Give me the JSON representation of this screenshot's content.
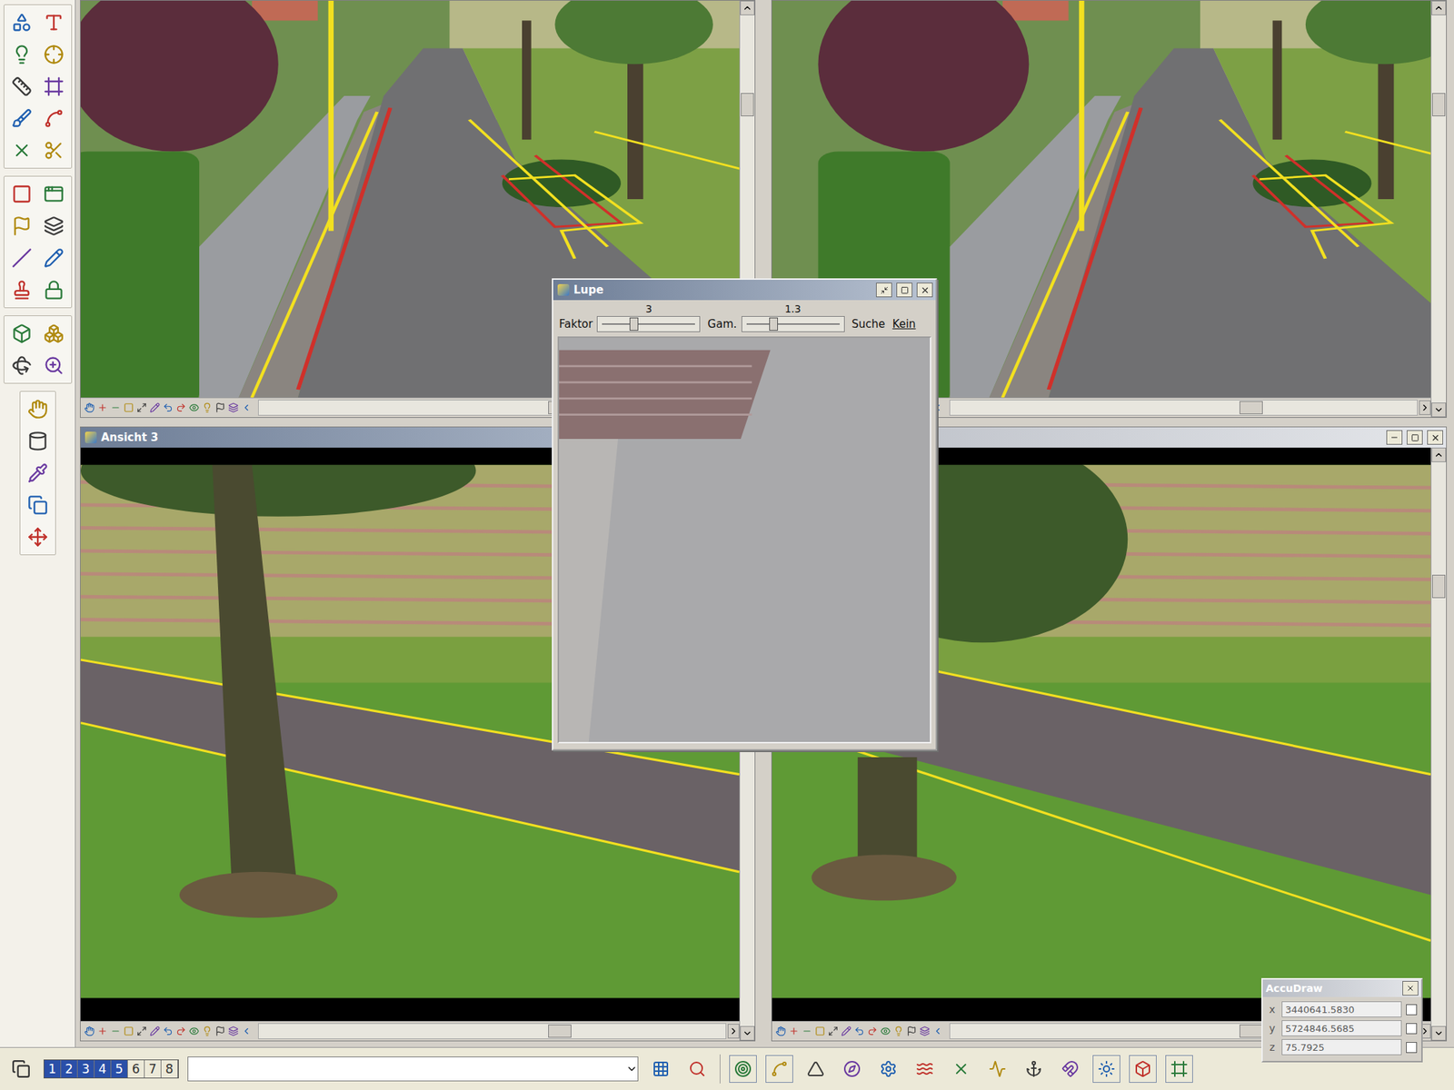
{
  "views": [
    {
      "kind": "street",
      "title": null
    },
    {
      "kind": "street",
      "title": null
    },
    {
      "kind": "field",
      "title": "Ansicht 3"
    },
    {
      "kind": "field",
      "title": ""
    }
  ],
  "magnifier": {
    "title": "Lupe",
    "sliders": [
      {
        "label": "Faktor",
        "value": "3",
        "level": 0.35
      },
      {
        "label": "Gam.",
        "value": "1.3",
        "level": 0.3
      }
    ],
    "buttons": [
      {
        "label": "Suche",
        "underlined": false
      },
      {
        "label": "Kein",
        "underlined": true
      }
    ]
  },
  "accudraw": {
    "title": "AccuDraw",
    "fields": [
      {
        "label": "x",
        "value": "3440641.5830",
        "locked": false
      },
      {
        "label": "y",
        "value": "5724846.5685",
        "locked": false
      },
      {
        "label": "z",
        "value": "75.7925",
        "locked": false
      }
    ]
  },
  "status_bar": {
    "view_buttons": [
      {
        "label": "1",
        "on": true
      },
      {
        "label": "2",
        "on": true
      },
      {
        "label": "3",
        "on": true
      },
      {
        "label": "4",
        "on": true
      },
      {
        "label": "5",
        "on": true
      },
      {
        "label": "6",
        "on": false
      },
      {
        "label": "7",
        "on": false
      },
      {
        "label": "8",
        "on": false
      }
    ],
    "command": {
      "value": ""
    }
  }
}
